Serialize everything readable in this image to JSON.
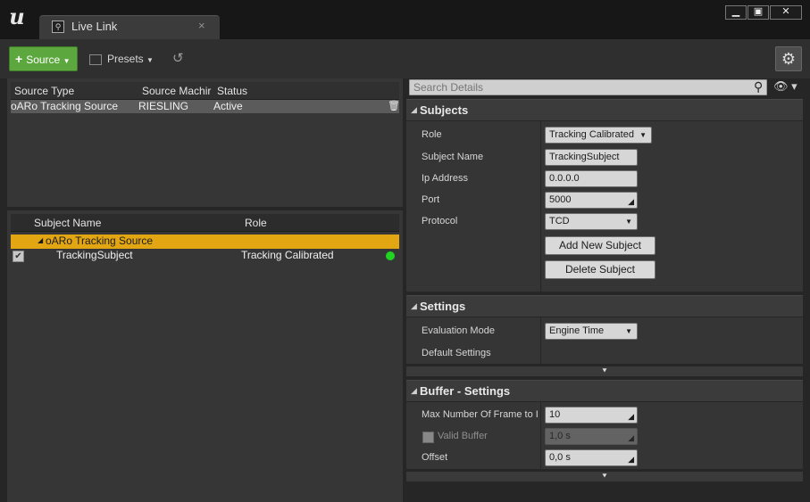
{
  "window": {
    "tab_title": "Live Link",
    "tab_close": "×",
    "controls": {
      "minimize": "▁",
      "maximize": "▣",
      "close": "✕"
    }
  },
  "toolbar": {
    "source_label": "Source",
    "presets_label": "Presets"
  },
  "sources": {
    "columns": [
      "Source Type",
      "Source Machir",
      "Status"
    ],
    "rows": [
      {
        "type": "oARo Tracking Source",
        "machine": "RIESLING",
        "status": "Active"
      }
    ]
  },
  "subjects_list": {
    "columns": [
      "Subject Name",
      "Role"
    ],
    "group": "oARo Tracking Source",
    "rows": [
      {
        "name": "TrackingSubject",
        "role": "Tracking Calibrated",
        "enabled": true,
        "status_color": "#21d421"
      }
    ]
  },
  "details": {
    "search_placeholder": "Search Details",
    "subjects": {
      "title": "Subjects",
      "role_label": "Role",
      "role_value": "Tracking Calibrated",
      "subject_name_label": "Subject Name",
      "subject_name_value": "TrackingSubject",
      "ip_label": "Ip Address",
      "ip_value": "0.0.0.0",
      "port_label": "Port",
      "port_value": "5000",
      "protocol_label": "Protocol",
      "protocol_value": "TCD",
      "add_button": "Add New Subject",
      "delete_button": "Delete Subject"
    },
    "settings": {
      "title": "Settings",
      "eval_label": "Evaluation Mode",
      "eval_value": "Engine Time",
      "default_label": "Default Settings"
    },
    "buffer": {
      "title": "Buffer - Settings",
      "max_frames_label": "Max Number Of Frame to I",
      "max_frames_value": "10",
      "valid_buffer_label": "Valid Buffer",
      "valid_buffer_value": "1,0 s",
      "offset_label": "Offset",
      "offset_value": "0,0 s"
    }
  },
  "colors": {
    "accent_green": "#5ca83f",
    "group_highlight": "#e2a613",
    "status_active": "#21d421"
  }
}
